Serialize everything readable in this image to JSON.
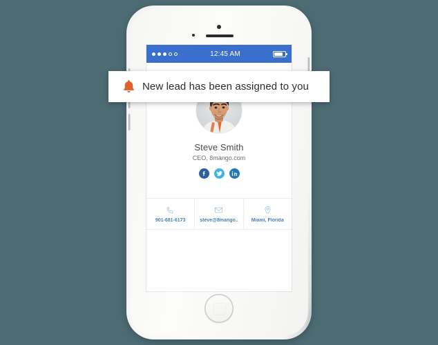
{
  "notification": {
    "icon": "bell-icon",
    "message": "New lead has been assigned to you"
  },
  "phone": {
    "status_bar": {
      "signal_filled": 3,
      "signal_empty": 2,
      "time": "12:45 AM",
      "battery_icon": "battery-icon",
      "battery_level": "80%",
      "background_color": "#3b6fce"
    },
    "profile": {
      "avatar": "user-photo",
      "name": "Steve Smith",
      "title": "CEO, 8mango.com",
      "social": [
        {
          "name": "facebook",
          "label": "f",
          "color": "#2d5f9a"
        },
        {
          "name": "twitter",
          "label": "t",
          "color": "#44b4e8"
        },
        {
          "name": "linkedin",
          "label": "in",
          "color": "#2577b5"
        }
      ],
      "contacts": [
        {
          "icon": "phone-icon",
          "label": "901-681-6173"
        },
        {
          "icon": "envelope-icon",
          "label": "steve@8mango.."
        },
        {
          "icon": "map-pin-icon",
          "label": "Miami, Florida"
        }
      ]
    },
    "home_button": "home-button"
  },
  "colors": {
    "background": "#4d6b73",
    "accent_blue": "#3b6fce",
    "accent_orange": "#e1602f",
    "link_blue": "#4a7fb5"
  }
}
